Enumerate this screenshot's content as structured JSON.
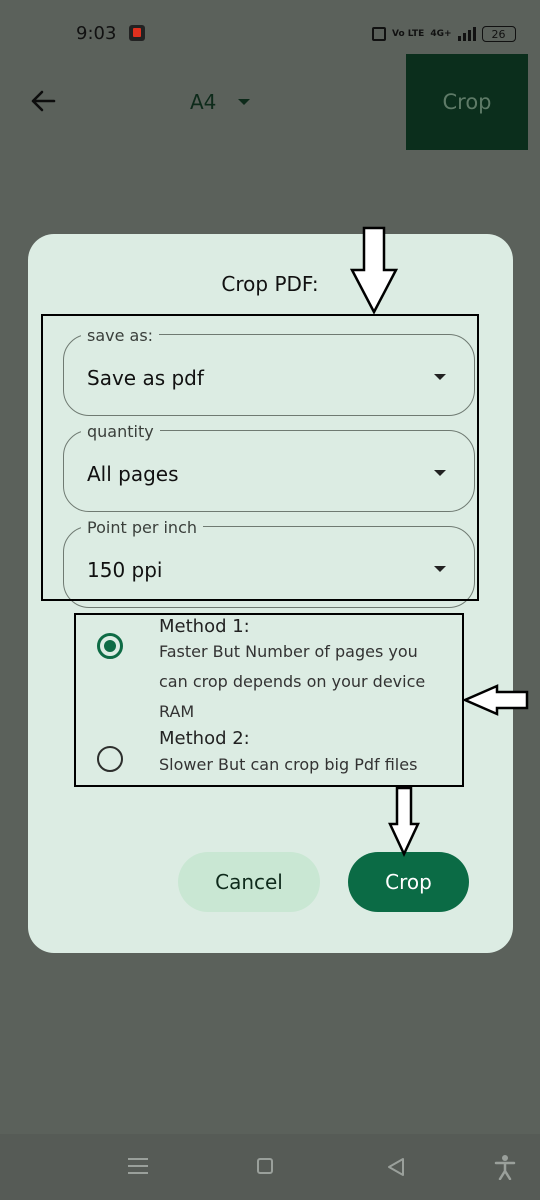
{
  "status_bar": {
    "time": "9:03",
    "volte": "Vo LTE",
    "network": "4G+",
    "battery": "26"
  },
  "toolbar": {
    "paper_size": "A4",
    "crop_label": "Crop"
  },
  "dialog": {
    "title": "Crop PDF:",
    "fields": [
      {
        "label": "save as:",
        "value": "Save as pdf"
      },
      {
        "label": "quantity",
        "value": "All pages"
      },
      {
        "label": "Point per inch",
        "value": "150 ppi"
      }
    ],
    "methods": [
      {
        "title": "Method 1:",
        "description_lines": [
          "Faster But Number of pages you",
          "can crop depends on your device",
          "RAM"
        ],
        "selected": true
      },
      {
        "title": "Method 2:",
        "description_lines": [
          "Slower But can crop big Pdf files"
        ],
        "selected": false
      }
    ],
    "cancel_label": "Cancel",
    "crop_label": "Crop"
  },
  "colors": {
    "accent": "#0b6b45",
    "dialog_bg": "#dcece3",
    "scrim": "#5b615b",
    "toolbar_crop_bg": "#0b2e1c"
  },
  "icons": [
    "back-arrow-icon",
    "dropdown-icon",
    "vibrate-icon",
    "signal-icon",
    "battery-icon",
    "menu-icon",
    "home-icon",
    "nav-back-icon",
    "accessibility-icon",
    "annotation-arrow-icon"
  ]
}
